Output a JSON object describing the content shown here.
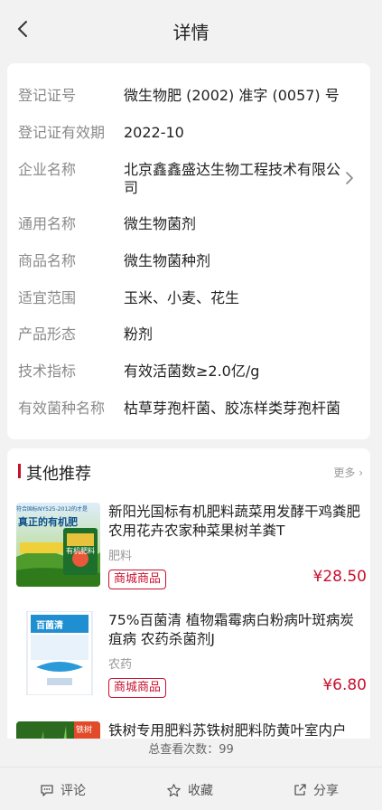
{
  "header": {
    "title": "详情"
  },
  "info": [
    {
      "label": "登记证号",
      "value": "微生物肥 (2002) 准字 (0057) 号"
    },
    {
      "label": "登记证有效期",
      "value": "2022-10"
    },
    {
      "label": "企业名称",
      "value": "北京鑫鑫盛达生物工程技术有限公司"
    },
    {
      "label": "通用名称",
      "value": "微生物菌剂"
    },
    {
      "label": "商品名称",
      "value": "微生物菌种剂"
    },
    {
      "label": "适宜范围",
      "value": "玉米、小麦、花生"
    },
    {
      "label": "产品形态",
      "value": "粉剂"
    },
    {
      "label": "技术指标",
      "value": "有效活菌数≥2.0亿/g"
    },
    {
      "label": "有效菌种名称",
      "value": "枯草芽孢杆菌、胶冻样类芽孢杆菌"
    }
  ],
  "recommend": {
    "title": "其他推荐",
    "more": "更多",
    "products": [
      {
        "name": "新阳光国标有机肥料蔬菜用发酵干鸡粪肥农用花卉农家种菜果树羊粪T",
        "category": "肥料",
        "badge": "商城商品",
        "price": "¥28.50",
        "thumb_text": [
          "符合国标NY525-2012的才是",
          "真正的有机肥",
          "有机肥料"
        ]
      },
      {
        "name": "75%百菌清 植物霜霉病白粉病叶斑病炭疽病 农药杀菌剂J",
        "category": "农药",
        "badge": "商城商品",
        "price": "¥6.80",
        "thumb_text": [
          "百菌清"
        ]
      },
      {
        "name": "铁树专用肥料苏铁树肥料防黄叶室内户",
        "thumb_text": [
          "铁树"
        ]
      }
    ]
  },
  "footer": {
    "view_count": "总查看次数：99",
    "actions": [
      "评论",
      "收藏",
      "分享"
    ]
  },
  "colors": {
    "accent": "#c8102e",
    "background": "#f2f2f2",
    "label": "#8a8a8a"
  }
}
